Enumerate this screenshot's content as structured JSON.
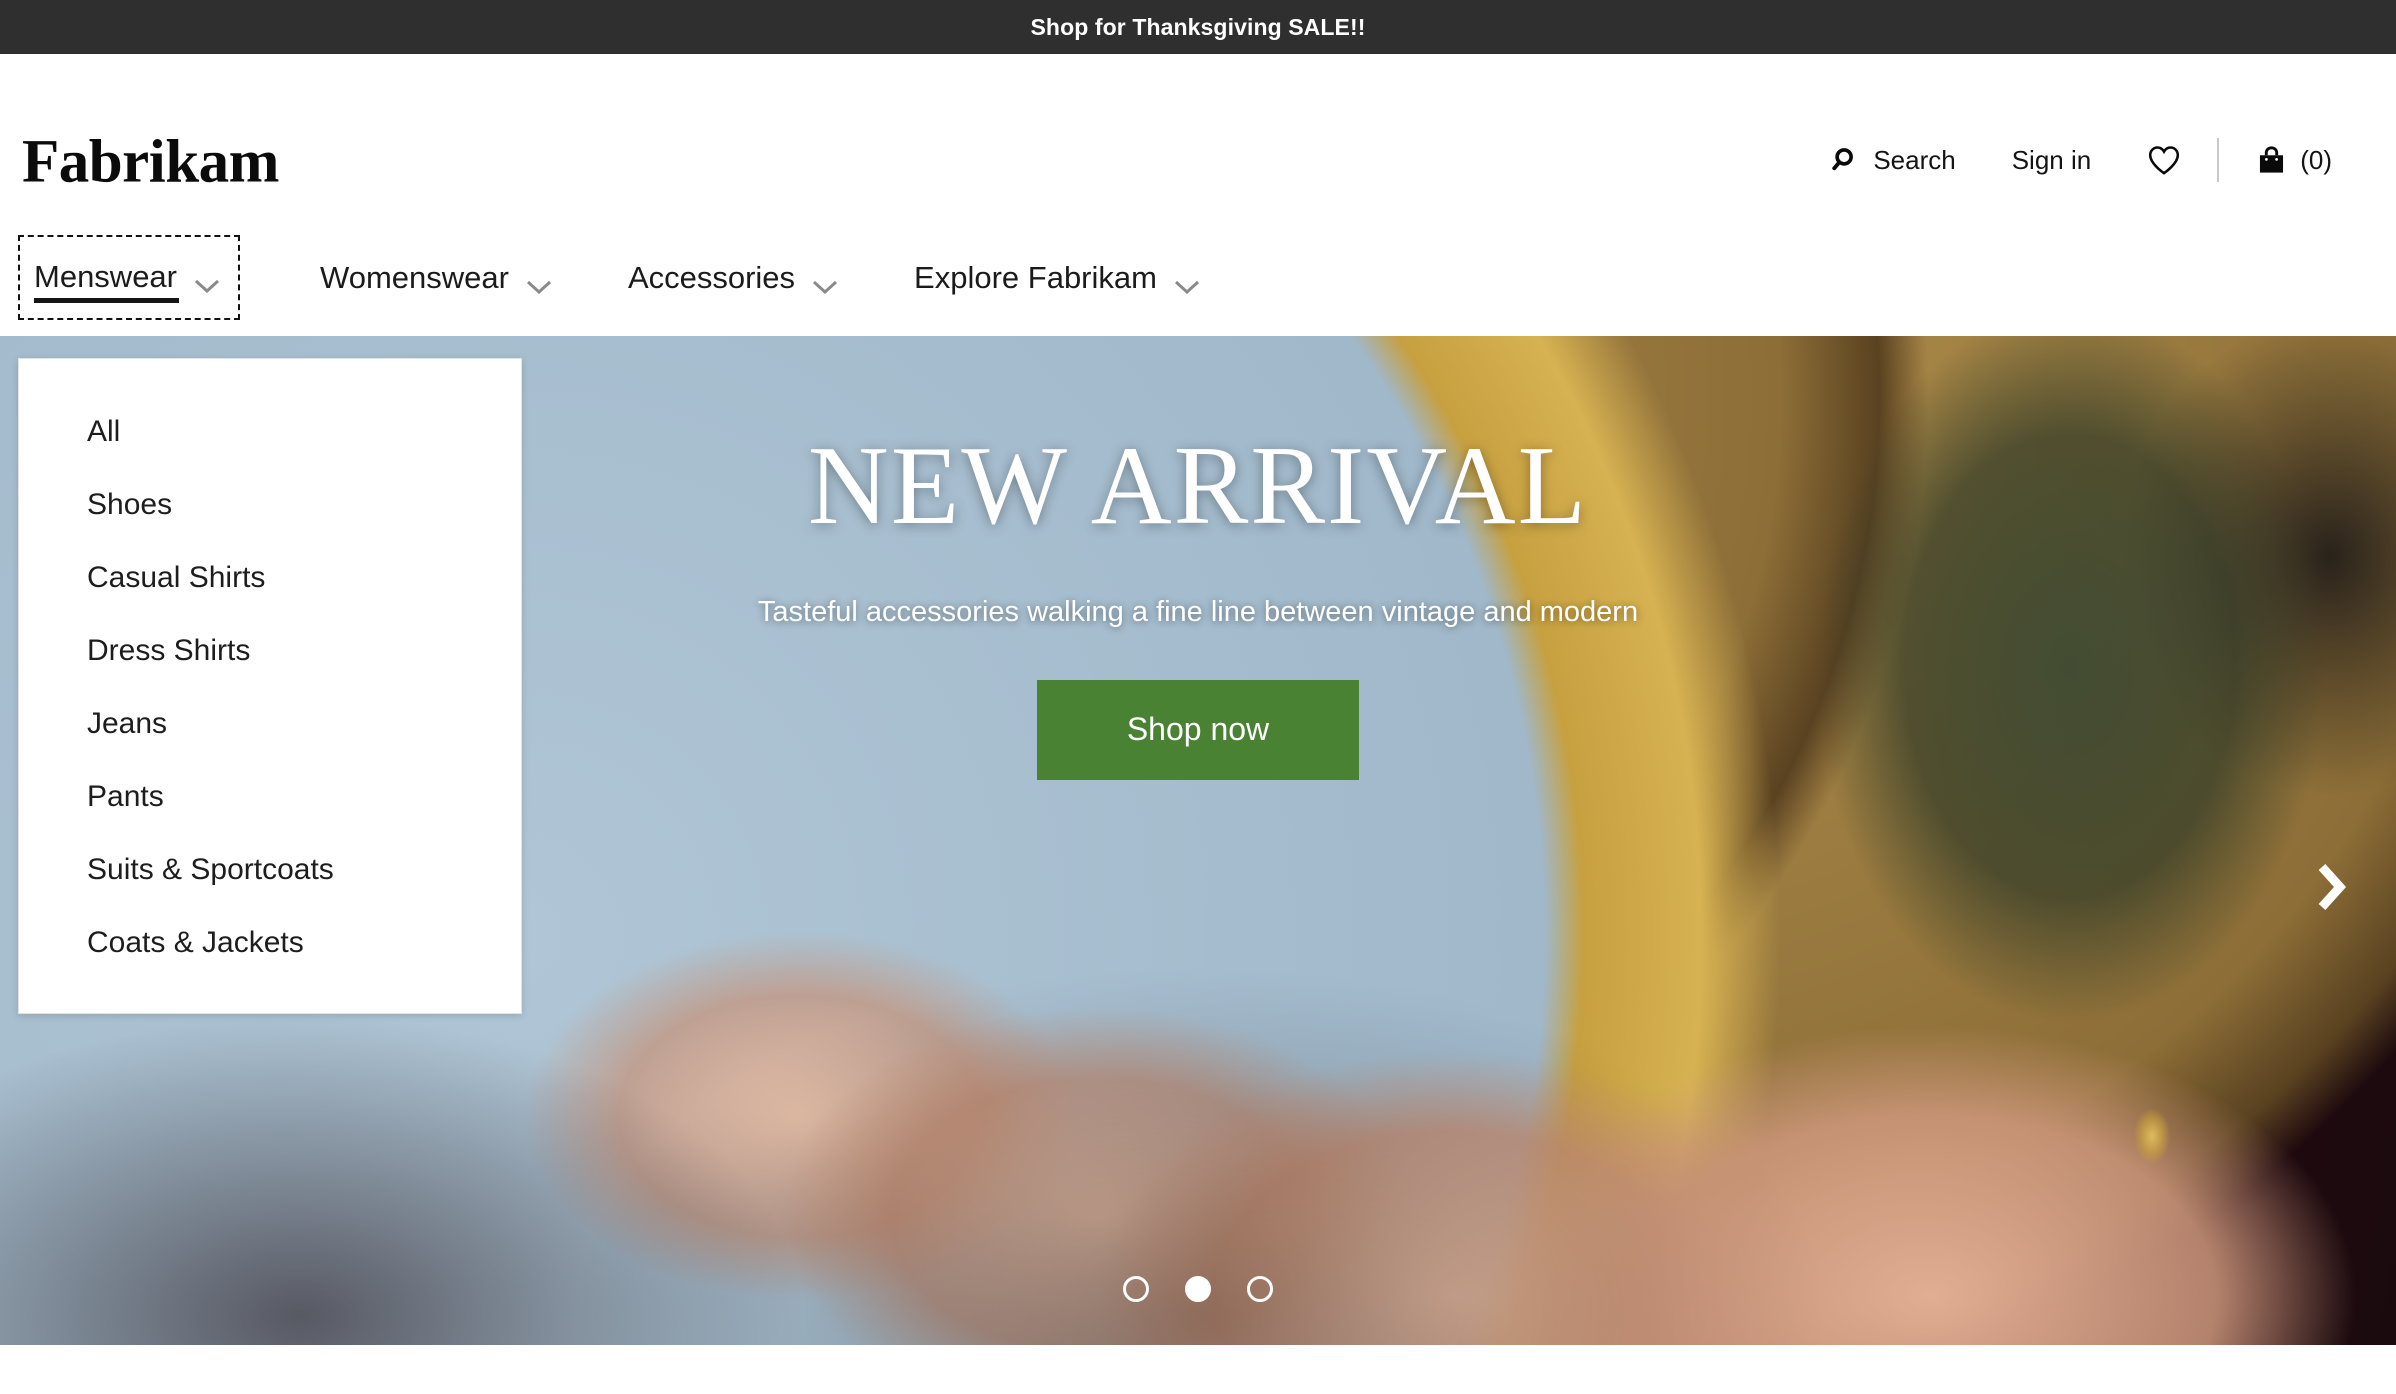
{
  "promo": {
    "text": "Shop for Thanksgiving SALE!!",
    "bg_color": "#2f2f2f"
  },
  "header": {
    "brand": "Fabrikam",
    "search_label": "Search",
    "search_icon": "search-icon",
    "signin_label": "Sign in",
    "wishlist_icon": "heart-icon",
    "cart_icon": "shopping-bag-icon",
    "cart_count": "(0)"
  },
  "nav": {
    "items": [
      {
        "label": "Menswear",
        "icon": "chevron-down-icon",
        "active": true
      },
      {
        "label": "Womenswear",
        "icon": "chevron-down-icon",
        "active": false
      },
      {
        "label": "Accessories",
        "icon": "chevron-down-icon",
        "active": false
      },
      {
        "label": "Explore Fabrikam",
        "icon": "chevron-down-icon",
        "active": false
      }
    ]
  },
  "menswear_dropdown": {
    "open": true,
    "items": [
      {
        "label": "All"
      },
      {
        "label": "Shoes"
      },
      {
        "label": "Casual Shirts"
      },
      {
        "label": "Dress Shirts"
      },
      {
        "label": "Jeans"
      },
      {
        "label": "Pants"
      },
      {
        "label": "Suits & Sportcoats"
      },
      {
        "label": "Coats & Jackets"
      }
    ]
  },
  "hero": {
    "title": "NEW ARRIVAL",
    "subtitle": "Tasteful accessories walking a fine line between vintage and modern",
    "cta_label": "Shop now",
    "cta_color": "#4a8233",
    "next_icon": "chevron-right-icon",
    "dots": [
      {
        "active": false
      },
      {
        "active": true
      },
      {
        "active": false
      }
    ]
  }
}
